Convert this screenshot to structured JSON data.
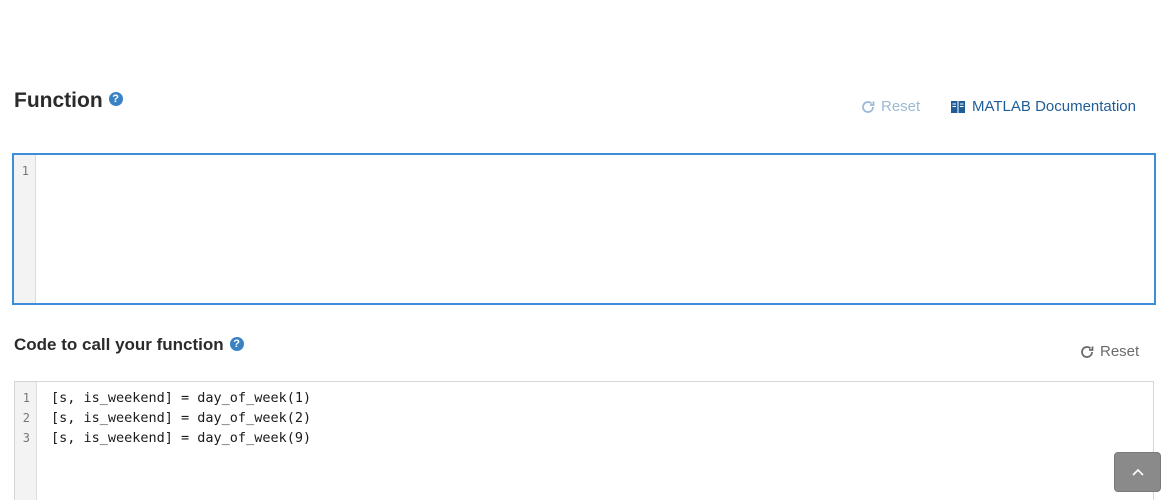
{
  "function_section": {
    "title": "Function",
    "help_icon": "question-circle-icon",
    "reset_label": "Reset",
    "docs_label": "MATLAB Documentation",
    "editor": {
      "line_numbers": [
        "1"
      ],
      "lines": [
        ""
      ]
    }
  },
  "call_section": {
    "title": "Code to call your function",
    "help_icon": "question-circle-icon",
    "reset_label": "Reset",
    "editor": {
      "line_numbers": [
        "1",
        "2",
        "3"
      ],
      "lines": [
        "[s, is_weekend] = day_of_week(1)",
        "[s, is_weekend] = day_of_week(2)",
        "[s, is_weekend] = day_of_week(9)"
      ]
    }
  },
  "colors": {
    "accent": "#3a8fd8",
    "link": "#1f5d99",
    "reset_disabled": "#9cbad6"
  }
}
